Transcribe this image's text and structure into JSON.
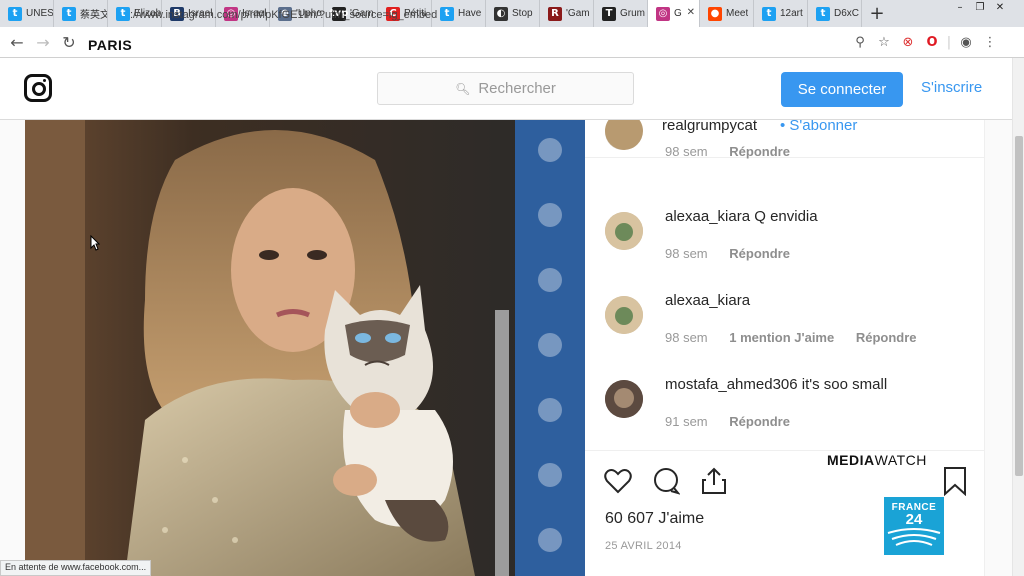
{
  "tabs": [
    {
      "title": "UNES",
      "icon": "twitter-icon",
      "color": "#1da1f2"
    },
    {
      "title": "蔡英文",
      "icon": "twitter-icon",
      "color": "#1da1f2"
    },
    {
      "title": "Elizab",
      "icon": "twitter-icon",
      "color": "#1da1f2"
    },
    {
      "title": "Israel",
      "icon": "bi-icon",
      "color": "#1f3a68"
    },
    {
      "title": "Israel",
      "icon": "instagram-icon",
      "color": "#c13584"
    },
    {
      "title": "'Upho",
      "icon": "globe-icon",
      "color": "#5a6e8c"
    },
    {
      "title": "'Gam",
      "icon": "tvp-icon",
      "color": "#222222"
    },
    {
      "title": "Pétiti",
      "icon": "c-icon",
      "color": "#e02020"
    },
    {
      "title": "Have",
      "icon": "twitter-icon",
      "color": "#1da1f2"
    },
    {
      "title": "Stop",
      "icon": "ring-icon",
      "color": "#333333"
    },
    {
      "title": "'Gam",
      "icon": "r-icon",
      "color": "#8b1a1a"
    },
    {
      "title": "Grum",
      "icon": "nyt-icon",
      "color": "#222222"
    },
    {
      "title": "G",
      "icon": "instagram-icon",
      "color": "#c13584",
      "active": true
    },
    {
      "title": "Meet",
      "icon": "reddit-icon",
      "color": "#ff4500"
    },
    {
      "title": "12art",
      "icon": "twitter-icon",
      "color": "#1da1f2"
    },
    {
      "title": "D6xC",
      "icon": "twitter-icon",
      "color": "#1da1f2"
    }
  ],
  "browser": {
    "url": "://www.instagram.com/p/nMpKfGE1Im/?utm_source=ig_embed",
    "overlay_city": "PARIS",
    "status": "En attente de www.facebook.com..."
  },
  "header": {
    "search_placeholder": "Rechercher",
    "login": "Se connecter",
    "signup": "S'inscrire"
  },
  "post": {
    "author": "realgrumpycat",
    "author_follow": "S'abonner",
    "comments": [
      {
        "user": "",
        "text": "",
        "age": "98 sem",
        "reply": "Répondre",
        "likes": ""
      },
      {
        "user": "alexaa_kiara",
        "text": "Q envidia",
        "age": "98 sem",
        "reply": "Répondre",
        "likes": ""
      },
      {
        "user": "alexaa_kiara",
        "text": "",
        "age": "98 sem",
        "reply": "Répondre",
        "likes": "1 mention J'aime"
      },
      {
        "user": "mostafa_ahmed306",
        "text": "it's soo small",
        "age": "91 sem",
        "reply": "Répondre",
        "likes": ""
      }
    ],
    "likes": "60 607 J'aime",
    "date": "25 AVRIL 2014"
  },
  "overlay": {
    "mediawatch_a": "MEDIA",
    "mediawatch_b": "WATCH",
    "france": "FRANCE",
    "num": "24"
  },
  "colors": {
    "accent": "#3897f0",
    "france24": "#1aa3d6"
  }
}
